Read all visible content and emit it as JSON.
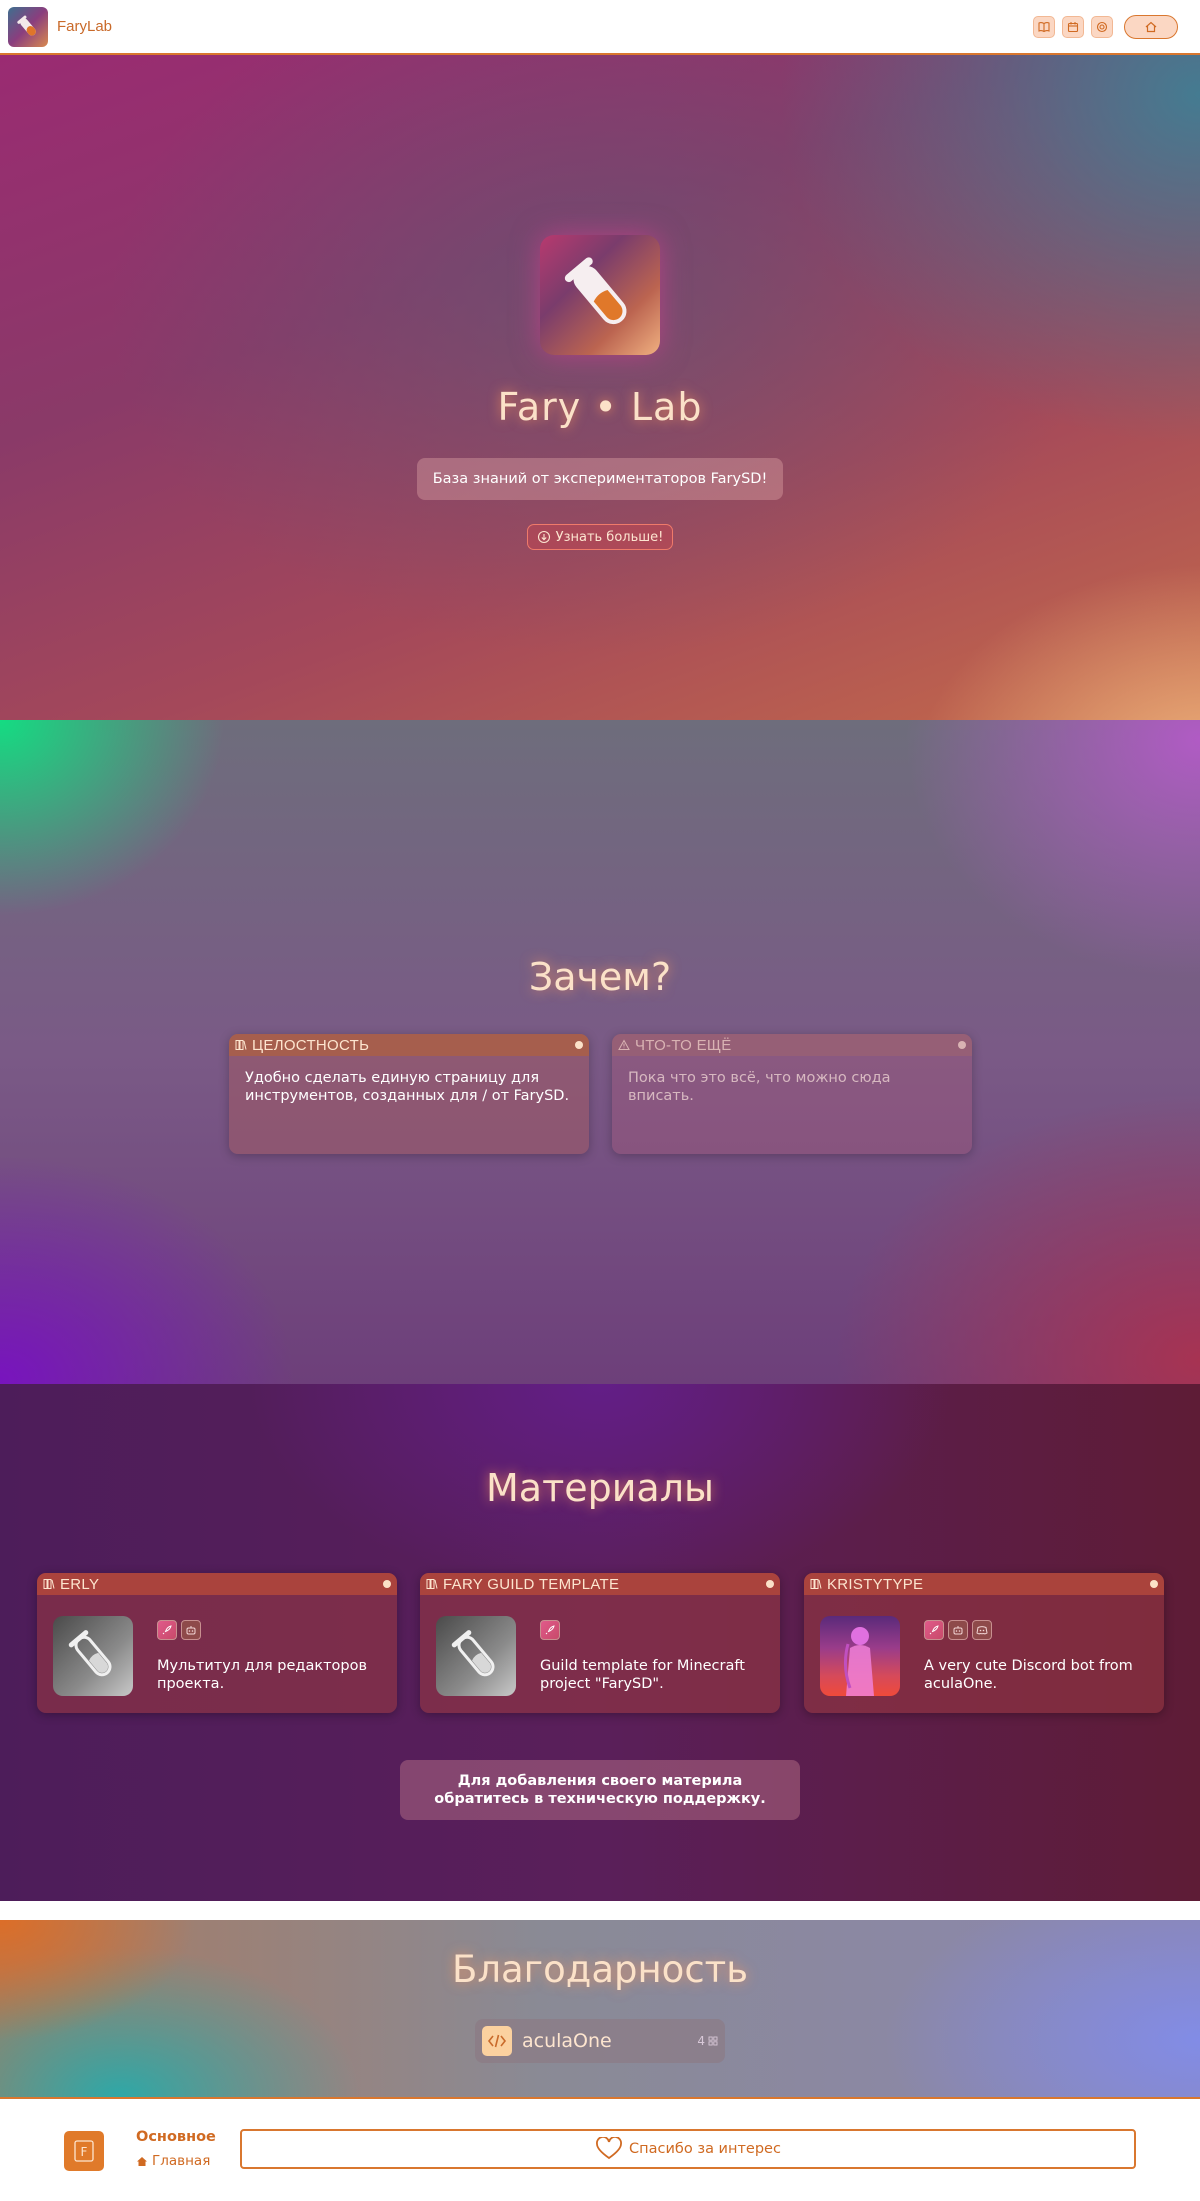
{
  "header": {
    "brand": "FaryLab",
    "actions": [
      {
        "name": "book-icon"
      },
      {
        "name": "calendar-icon"
      },
      {
        "name": "target-icon"
      }
    ],
    "home_icon": "home-icon"
  },
  "hero": {
    "logo_icon": "flask-icon",
    "title": "Fary • Lab",
    "subtitle": "База знаний от экспериментаторов FarySD!",
    "learn_more": "Узнать больше!",
    "learn_more_icon": "arrow-down-circle-icon"
  },
  "why": {
    "title": "Зачем?",
    "cards": [
      {
        "icon": "library-icon",
        "heading": "ЦЕЛОСТНОСТЬ",
        "text": "Удобно сделать единую страницу для инструментов, созданных для / от FarySD."
      },
      {
        "icon": "warning-icon",
        "heading": "ЧТО-ТО ЕЩЁ",
        "text": "Пока что это всё, что можно сюда вписать."
      }
    ]
  },
  "materials": {
    "title": "Материалы",
    "cards": [
      {
        "heading": "ERLY",
        "tags": [
          "rocket-icon",
          "bot-icon"
        ],
        "text": "Мультитул для редакторов проекта."
      },
      {
        "heading": "FARY GUILD TEMPLATE",
        "tags": [
          "rocket-icon"
        ],
        "text": "Guild template for Minecraft project \"FarySD\"."
      },
      {
        "heading": "KRISTYTYPE",
        "tags": [
          "rocket-icon",
          "bot-icon",
          "discord-icon"
        ],
        "text": "A very cute Discord bot from aculaOne."
      }
    ],
    "note": "Для добавления своего материла обратитесь в техническую поддержку."
  },
  "thanks": {
    "title": "Благодарность",
    "contributor": {
      "name": "aculaOne",
      "count": "4",
      "icon": "code-icon"
    }
  },
  "footer": {
    "logo": "F",
    "section": "Основное",
    "link": "Главная",
    "thanks_button": "Спасибо за интерес"
  },
  "colors": {
    "accent": "#d9772f",
    "title_glow": "#fbe1c8"
  }
}
